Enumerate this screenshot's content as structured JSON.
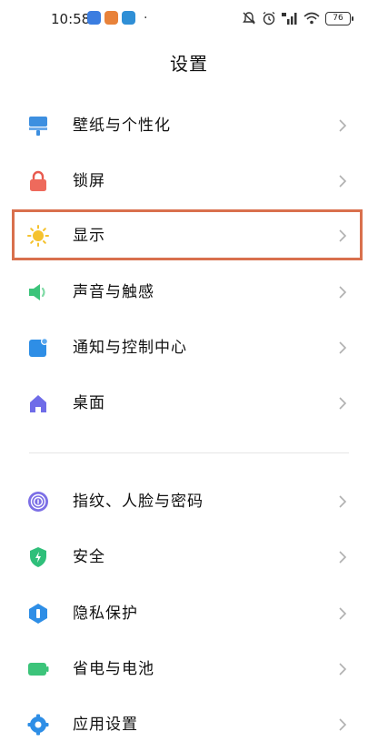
{
  "status_bar": {
    "time": "10:58",
    "more_dot": "·",
    "battery": "76",
    "notif_colors": [
      "#3b7de0",
      "#e8823a",
      "#2f8fd6"
    ]
  },
  "header": {
    "title": "设置"
  },
  "colors": {
    "highlight": "#d9704d"
  },
  "groups": [
    {
      "items": [
        {
          "label": "壁纸与个性化",
          "icon": "wallpaper-icon"
        },
        {
          "label": "锁屏",
          "icon": "lock-icon"
        },
        {
          "label": "显示",
          "icon": "sun-icon",
          "highlighted": true
        },
        {
          "label": "声音与触感",
          "icon": "speaker-icon"
        },
        {
          "label": "通知与控制中心",
          "icon": "notification-icon"
        },
        {
          "label": "桌面",
          "icon": "home-icon"
        }
      ]
    },
    {
      "items": [
        {
          "label": "指纹、人脸与密码",
          "icon": "fingerprint-icon"
        },
        {
          "label": "安全",
          "icon": "shield-icon"
        },
        {
          "label": "隐私保护",
          "icon": "privacy-icon"
        },
        {
          "label": "省电与电池",
          "icon": "battery-icon"
        },
        {
          "label": "应用设置",
          "icon": "gear-icon"
        }
      ]
    }
  ]
}
